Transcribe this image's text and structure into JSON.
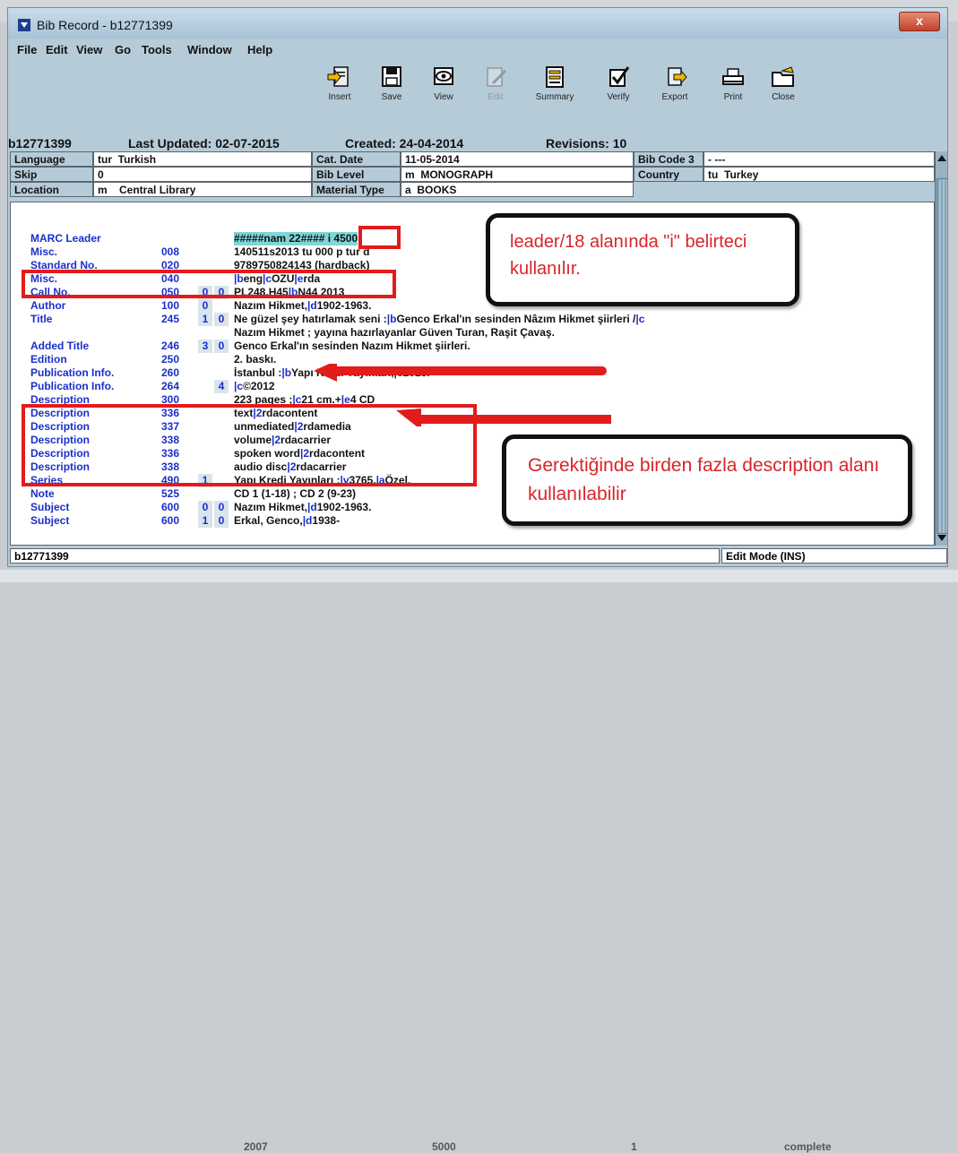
{
  "window": {
    "title": "Bib Record - b12771399",
    "close_glyph": "x"
  },
  "menu": [
    "File",
    "Edit",
    "View",
    "Go",
    "Tools",
    "Window",
    "Help"
  ],
  "toolbar": [
    {
      "label": "Insert",
      "icon": "insert-icon",
      "enabled": true
    },
    {
      "label": "Save",
      "icon": "save-icon",
      "enabled": true
    },
    {
      "label": "View",
      "icon": "view-icon",
      "enabled": true
    },
    {
      "label": "Edit",
      "icon": "edit-icon",
      "enabled": false
    },
    {
      "label": "Summary",
      "icon": "summary-icon",
      "enabled": true
    },
    {
      "label": "Verify",
      "icon": "verify-icon",
      "enabled": true
    },
    {
      "label": "Export",
      "icon": "export-icon",
      "enabled": true
    },
    {
      "label": "Print",
      "icon": "print-icon",
      "enabled": true
    },
    {
      "label": "Close",
      "icon": "close-folder-icon",
      "enabled": true
    }
  ],
  "record_header": {
    "record_number": "b12771399",
    "last_updated": "Last Updated: 02-07-2015",
    "created": "Created: 24-04-2014",
    "revisions": "Revisions: 10"
  },
  "fixed_fields": {
    "language_label": "Language",
    "language_code": "tur",
    "language_value": "Turkish",
    "cat_date_label": "Cat. Date",
    "cat_date_value": "11-05-2014",
    "bib_code3_label": "Bib Code 3",
    "bib_code3_value": "-  ---",
    "skip_label": "Skip",
    "skip_value": "0",
    "bib_level_label": "Bib Level",
    "bib_level_code": "m",
    "bib_level_value": "MONOGRAPH",
    "country_label": "Country",
    "country_code": "tu",
    "country_value": "Turkey",
    "location_label": "Location",
    "location_code": "m",
    "location_value": "Central Library",
    "material_type_label": "Material Type",
    "material_type_code": "a",
    "material_type_value": "BOOKS"
  },
  "marc_fields": [
    {
      "label": "MARC Leader",
      "tag": "",
      "i1": "",
      "i2": "",
      "text": "#####nam  22####  i 4500"
    },
    {
      "label": "Misc.",
      "tag": "008",
      "i1": "",
      "i2": "",
      "text": "140511s2013    tu          000 p tur d"
    },
    {
      "label": "Standard No.",
      "tag": "020",
      "i1": "",
      "i2": "",
      "text": "9789750824143 (hardback)"
    },
    {
      "label": "Misc.",
      "tag": "040",
      "i1": "",
      "i2": "",
      "text": "|beng|cOZU|erda"
    },
    {
      "label": "Call No.",
      "tag": "050",
      "i1": "0",
      "i2": "0",
      "text": "PL248.H45|bN44 2013"
    },
    {
      "label": "Author",
      "tag": "100",
      "i1": "0",
      "i2": "",
      "text": "Nazım Hikmet,|d1902-1963."
    },
    {
      "label": "Title",
      "tag": "245",
      "i1": "1",
      "i2": "0",
      "text": "Ne güzel şey hatırlamak seni :|bGenco Erkal'ın sesinden Nâzım Hikmet şiirleri /|c"
    },
    {
      "label": "",
      "tag": "",
      "i1": "",
      "i2": "",
      "text": "Nazım Hikmet ; yayına hazırlayanlar Güven Turan, Raşit Çavaş."
    },
    {
      "label": "Added Title",
      "tag": "246",
      "i1": "3",
      "i2": "0",
      "text": "Genco Erkal'ın sesinden Nazım Hikmet şiirleri."
    },
    {
      "label": "Edition",
      "tag": "250",
      "i1": "",
      "i2": "",
      "text": "2. baskı."
    },
    {
      "label": "Publication Info.",
      "tag": "260",
      "i1": "",
      "i2": "",
      "text": "İstanbul :|bYapı Kredi Yayınları,|c2013."
    },
    {
      "label": "Publication Info.",
      "tag": "264",
      "i1": "",
      "i2": "4",
      "text": "|c©2012"
    },
    {
      "label": "Description",
      "tag": "300",
      "i1": "",
      "i2": "",
      "text": "223 pages ;|c21 cm.+|e4 CD"
    },
    {
      "label": "Description",
      "tag": "336",
      "i1": "",
      "i2": "",
      "text": "text|2rdacontent"
    },
    {
      "label": "Description",
      "tag": "337",
      "i1": "",
      "i2": "",
      "text": "unmediated|2rdamedia"
    },
    {
      "label": "Description",
      "tag": "338",
      "i1": "",
      "i2": "",
      "text": "volume|2rdacarrier"
    },
    {
      "label": "Description",
      "tag": "336",
      "i1": "",
      "i2": "",
      "text": "spoken word|2rdacontent"
    },
    {
      "label": "Description",
      "tag": "338",
      "i1": "",
      "i2": "",
      "text": "audio disc|2rdacarrier"
    },
    {
      "label": "Series",
      "tag": "490",
      "i1": "1",
      "i2": "",
      "text": "Yapı Kredi Yayınları ;|v3765.|aÖzel."
    },
    {
      "label": "Note",
      "tag": "525",
      "i1": "",
      "i2": "",
      "text": "CD 1 (1-18) ; CD 2 (9-23)"
    },
    {
      "label": "Subject",
      "tag": "600",
      "i1": "0",
      "i2": "0",
      "text": "Nazım Hikmet,|d1902-1963."
    },
    {
      "label": "Subject",
      "tag": "600",
      "i1": "1",
      "i2": "0",
      "text": "Erkal, Genco,|d1938-"
    }
  ],
  "status": {
    "record": "b12771399",
    "mode": "Edit Mode (INS)"
  },
  "annotations": {
    "callout_leader": "leader/18 alanında \"i\" belirteci kullanılır.",
    "callout_description": "Gerektiğinde birden fazla description alanı kullanılabilir",
    "accent_color": "#e21b1b"
  },
  "background": {
    "bottom_values": [
      "2007",
      "5000",
      "1",
      "complete"
    ]
  }
}
